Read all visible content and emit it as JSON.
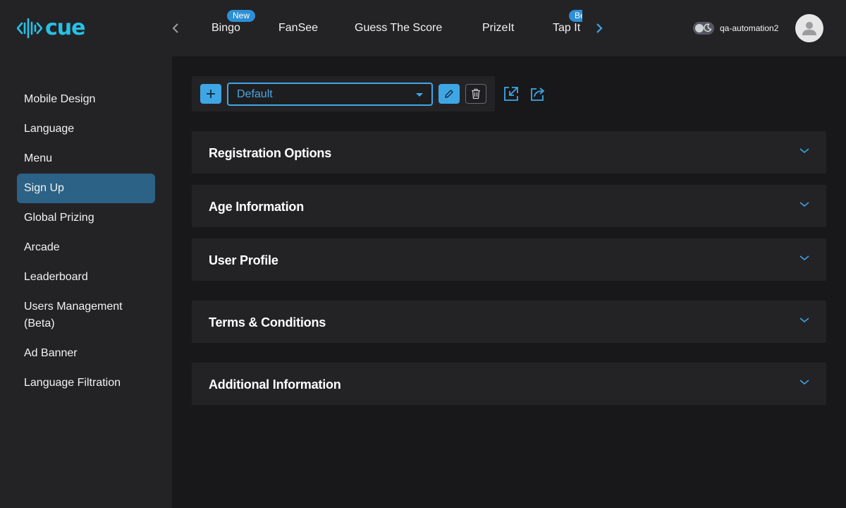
{
  "app": {
    "logo_text": "cue"
  },
  "header": {
    "tabs": [
      {
        "label": "Bingo",
        "badge": "New"
      },
      {
        "label": "FanSee"
      },
      {
        "label": "Guess The Score"
      },
      {
        "label": "PrizeIt"
      },
      {
        "label": "Tap It",
        "badge": "Beta"
      }
    ],
    "username": "qa-automation2"
  },
  "sidebar": {
    "items": [
      {
        "label": "Mobile Design"
      },
      {
        "label": "Language"
      },
      {
        "label": "Menu"
      },
      {
        "label": "Sign Up",
        "active": true
      },
      {
        "label": "Global Prizing"
      },
      {
        "label": "Arcade"
      },
      {
        "label": "Leaderboard"
      },
      {
        "label": "Users Management (Beta)"
      },
      {
        "label": "Ad Banner"
      },
      {
        "label": "Language Filtration"
      }
    ]
  },
  "toolbar": {
    "selected_config": "Default"
  },
  "sections": [
    {
      "title": "Registration Options"
    },
    {
      "title": "Age Information"
    },
    {
      "title": "User Profile"
    },
    {
      "title": "Terms & Conditions"
    },
    {
      "title": "Additional Information"
    }
  ],
  "colors": {
    "accent": "#3fa6e6",
    "logo": "#27c1e6",
    "active_nav": "#2b6285",
    "panel": "#232326",
    "background": "#18181b"
  }
}
